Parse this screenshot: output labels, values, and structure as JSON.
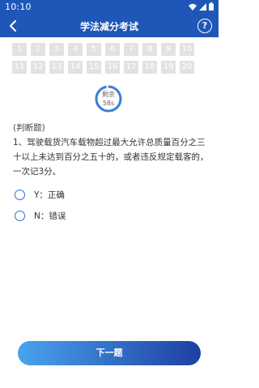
{
  "status_bar": {
    "time": "10:10"
  },
  "header": {
    "back_icon": "chevron-left-icon",
    "title": "学法减分考试",
    "help_label": "?"
  },
  "question_grid": {
    "numbers": [
      "1",
      "2",
      "3",
      "4",
      "5",
      "6",
      "7",
      "8",
      "9",
      "10",
      "11",
      "12",
      "13",
      "14",
      "15",
      "16",
      "17",
      "18",
      "19",
      "20"
    ]
  },
  "timer": {
    "label": "剩余",
    "value": "58s",
    "remaining_fraction": 0.97
  },
  "question": {
    "type": "(判断题)",
    "text": "1、驾驶载货汽车载物超过最大允许总质量百分之三十以上未达到百分之五十的，或者违反规定载客的，一次记3分。"
  },
  "options": [
    {
      "label": "Y：正确"
    },
    {
      "label": "N：错误"
    }
  ],
  "next_button": {
    "label": "下一题"
  },
  "colors": {
    "header": "#1f57b8",
    "accent": "#2f6fd1",
    "cell": "#e2e2e2"
  }
}
